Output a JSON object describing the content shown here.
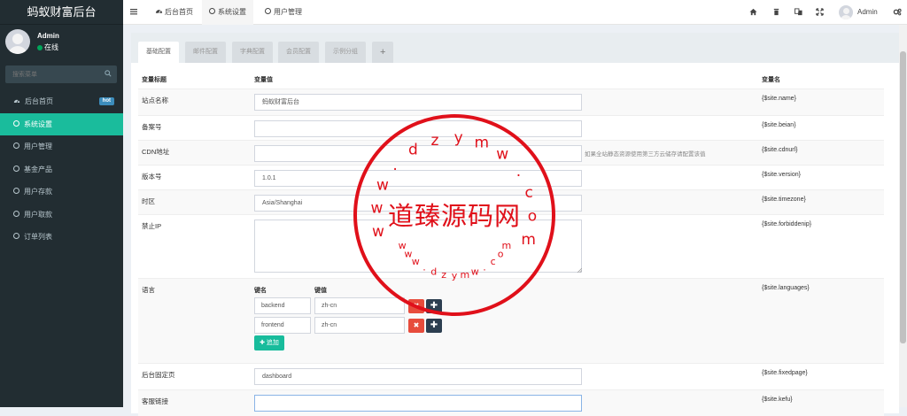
{
  "app": {
    "title": "蚂蚁财富后台"
  },
  "user": {
    "name": "Admin",
    "status": "在线"
  },
  "search": {
    "placeholder": "搜索菜单"
  },
  "sidebar": {
    "items": [
      {
        "label": "后台首页",
        "icon": "dashboard-icon",
        "badge": "hot"
      },
      {
        "label": "系统设置",
        "icon": "circle-icon",
        "active": true
      },
      {
        "label": "用户管理",
        "icon": "circle-icon"
      },
      {
        "label": "基金产品",
        "icon": "circle-icon"
      },
      {
        "label": "用户存款",
        "icon": "circle-icon"
      },
      {
        "label": "用户取款",
        "icon": "circle-icon"
      },
      {
        "label": "订单列表",
        "icon": "circle-icon"
      }
    ]
  },
  "topbar": {
    "tabs": [
      {
        "label": "后台首页",
        "icon": "dashboard-icon"
      },
      {
        "label": "系统设置",
        "icon": "circle-icon",
        "active": true
      },
      {
        "label": "用户管理",
        "icon": "circle-icon"
      }
    ],
    "username": "Admin",
    "icons": [
      "home-icon",
      "trash-icon",
      "translate-icon",
      "fullscreen-icon",
      "gears-icon"
    ]
  },
  "config_tabs": [
    {
      "label": "基础配置",
      "active": true
    },
    {
      "label": "邮件配置"
    },
    {
      "label": "字典配置"
    },
    {
      "label": "会员配置"
    },
    {
      "label": "示例分组"
    },
    {
      "label": "+"
    }
  ],
  "table": {
    "headers": {
      "title": "变量标题",
      "value": "变量值",
      "name": "变量名"
    },
    "rows": {
      "site_name": {
        "label": "站点名称",
        "value": "蚂蚁财富后台",
        "var": "{$site.name}"
      },
      "beian": {
        "label": "备案号",
        "value": "",
        "var": "{$site.beian}"
      },
      "cdnurl": {
        "label": "CDN地址",
        "value": "",
        "hint": "如果全站静态资源使用第三方云储存请配置该值",
        "var": "{$site.cdnurl}"
      },
      "version": {
        "label": "版本号",
        "value": "1.0.1",
        "var": "{$site.version}"
      },
      "timezone": {
        "label": "时区",
        "value": "Asia/Shanghai",
        "var": "{$site.timezone}"
      },
      "forbiddenip": {
        "label": "禁止IP",
        "value": "",
        "var": "{$site.forbiddenip}"
      },
      "languages": {
        "label": "语言",
        "key_header": "键名",
        "value_header": "键值",
        "pairs": [
          {
            "key": "backend",
            "value": "zh-cn"
          },
          {
            "key": "frontend",
            "value": "zh-cn"
          }
        ],
        "add_label": "追加",
        "var": "{$site.languages}"
      },
      "fixedpage": {
        "label": "后台固定页",
        "value": "dashboard",
        "var": "{$site.fixedpage}"
      },
      "kefu": {
        "label": "客服链接",
        "value": "",
        "var": "{$site.kefu}"
      }
    }
  },
  "watermark": {
    "center_text": "道臻源码网",
    "top_chars": [
      "w",
      "w",
      "w",
      ".",
      "d",
      "z",
      "y",
      "m",
      "w",
      ".",
      "c",
      "o",
      "m"
    ],
    "bottom_chars": [
      "w",
      "w",
      "w",
      ".",
      "d",
      "z",
      "y",
      "m",
      "w",
      ".",
      "c",
      "o",
      "m"
    ],
    "color": "#e0101a"
  }
}
